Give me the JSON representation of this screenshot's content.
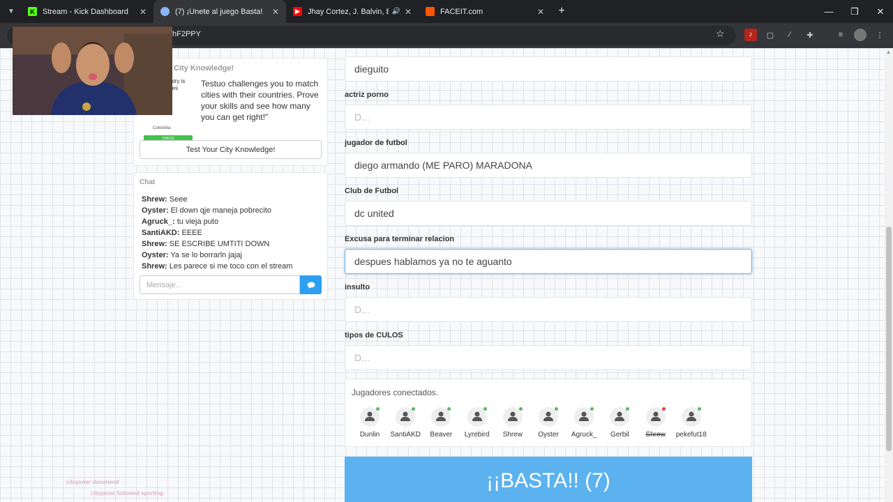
{
  "browser": {
    "tabs": [
      {
        "title": "Stream - Kick Dashboard",
        "icon": "kick-icon",
        "color": "#53fc18"
      },
      {
        "title": "(7) ¡Únete al juego Basta!",
        "icon": "basta-icon",
        "color": "#8ab4f8"
      },
      {
        "title": "Jhay Cortez, J. Balvin, Bad B",
        "icon": "youtube-icon",
        "color": "#ff0000"
      },
      {
        "title": "FACEIT.com",
        "icon": "faceit-icon",
        "color": "#ff5500"
      }
    ],
    "new_tab": "+",
    "url": "hF2PPY",
    "ext_badge": "2"
  },
  "promo": {
    "title": "City Knowledge!",
    "snippet": "ntry is res",
    "country": "Colombia",
    "check": "CHECK",
    "text": "Testuo challenges you to match cities with their countries. Prove your skills and see how many you can get right!\"",
    "button": "Test Your City Knowledge!"
  },
  "chat": {
    "title": "Chat",
    "messages": [
      {
        "user": "Shrew:",
        "text": " Seee"
      },
      {
        "user": "Oyster:",
        "text": " El down qje maneja pobrecito"
      },
      {
        "user": "Agruck_:",
        "text": " tu vieja puto"
      },
      {
        "user": "SantiAKD:",
        "text": " EEEE"
      },
      {
        "user": "Shrew:",
        "text": " SE ESCRIBE UMTITI DOWN"
      },
      {
        "user": "Oyster:",
        "text": " Ya se lo borrarln jajaj"
      },
      {
        "user": "Shrew:",
        "text": " Les parece si me toco con el stream"
      }
    ],
    "input_placeholder": "Mensaje..."
  },
  "form": {
    "top_value": "dieguito",
    "fields": [
      {
        "label": "actriz porno",
        "value": "",
        "placeholder": "D..."
      },
      {
        "label": "jugador de futbol",
        "value": "diego armando (ME PARO) MARADONA",
        "placeholder": "D..."
      },
      {
        "label": "Club de Futbol",
        "value": "dc united",
        "placeholder": "D..."
      },
      {
        "label": "Excusa para terminar relacion",
        "value": "despues hablamos ya no te aguanto",
        "placeholder": "D..."
      },
      {
        "label": "insulto",
        "value": "",
        "placeholder": "D..."
      },
      {
        "label": "tipos de CULOS",
        "value": "",
        "placeholder": "D..."
      }
    ]
  },
  "players": {
    "title": "Jugadores conectados.",
    "list": [
      {
        "name": "Dunlin",
        "status_color": "#5cb85c"
      },
      {
        "name": "SantiAKD",
        "status_color": "#5cb85c"
      },
      {
        "name": "Beaver",
        "status_color": "#5cb85c"
      },
      {
        "name": "Lyrebird",
        "status_color": "#5cb85c"
      },
      {
        "name": "Shrew",
        "status_color": "#5cb85c"
      },
      {
        "name": "Oyster",
        "status_color": "#5cb85c"
      },
      {
        "name": "Agruck_",
        "status_color": "#5cb85c"
      },
      {
        "name": "Gerbil",
        "status_color": "#5cb85c"
      },
      {
        "name": "Shrew",
        "status_color": "#e53935"
      },
      {
        "name": "pekefut18",
        "status_color": "#5cb85c"
      }
    ]
  },
  "basta_button": "¡¡BASTA!! (7)",
  "overlay": {
    "line1": "citojavier  donanend",
    "line2": "citojavier  followed  sporting"
  }
}
